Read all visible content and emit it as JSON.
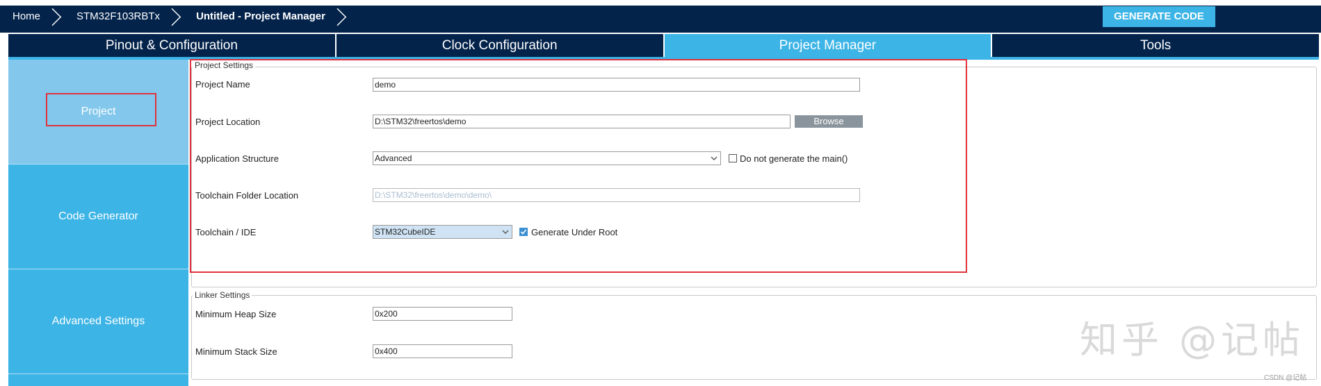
{
  "breadcrumb": {
    "items": [
      "Home",
      "STM32F103RBTx",
      "Untitled - Project Manager"
    ]
  },
  "toolbar": {
    "generate_label": "GENERATE CODE"
  },
  "tabs": [
    {
      "label": "Pinout & Configuration"
    },
    {
      "label": "Clock Configuration"
    },
    {
      "label": "Project Manager"
    },
    {
      "label": "Tools"
    }
  ],
  "sidebar": {
    "items": [
      {
        "label": "Project"
      },
      {
        "label": "Code Generator"
      },
      {
        "label": "Advanced Settings"
      }
    ]
  },
  "project_settings": {
    "legend": "Project Settings",
    "project_name_label": "Project Name",
    "project_name_value": "demo",
    "project_location_label": "Project Location",
    "project_location_value": "D:\\STM32\\freertos\\demo",
    "browse_label": "Browse",
    "app_structure_label": "Application Structure",
    "app_structure_value": "Advanced",
    "no_main_label": "Do not generate the main()",
    "toolchain_folder_label": "Toolchain Folder Location",
    "toolchain_folder_value": "D:\\STM32\\freertos\\demo\\demo\\",
    "toolchain_ide_label": "Toolchain / IDE",
    "toolchain_ide_value": "STM32CubeIDE",
    "generate_root_label": "Generate Under Root"
  },
  "linker_settings": {
    "legend": "Linker Settings",
    "heap_label": "Minimum Heap Size",
    "heap_value": "0x200",
    "stack_label": "Minimum Stack Size",
    "stack_value": "0x400"
  },
  "watermark": {
    "text": "知乎 @记帖",
    "csdn": "CSDN @记帖"
  },
  "colors": {
    "navy": "#03234b",
    "accent": "#3cb4e6",
    "highlight": "#e0323c"
  }
}
